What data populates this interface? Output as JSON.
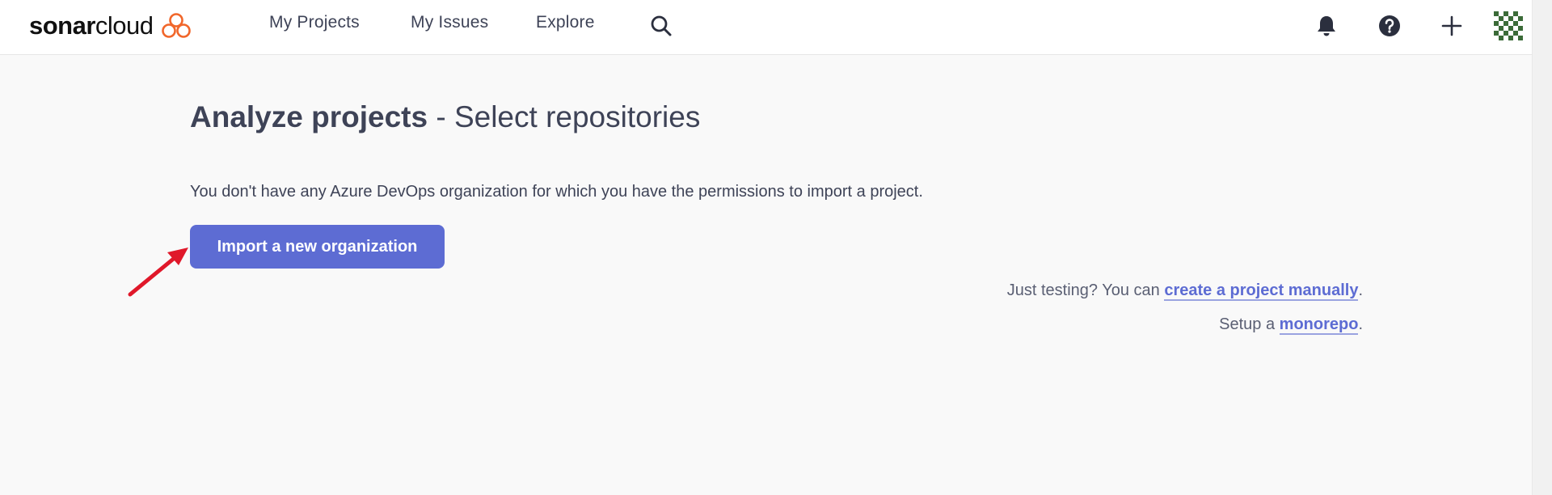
{
  "header": {
    "logo": {
      "part1": "sonar",
      "part2": "cloud",
      "icon": "sonarcloud-cloud-icon",
      "accent": "#f1662a"
    },
    "nav": [
      {
        "label": "My Projects"
      },
      {
        "label": "My Issues"
      },
      {
        "label": "Explore"
      }
    ],
    "icons": [
      "search-icon",
      "bell-icon",
      "help-icon",
      "plus-icon",
      "avatar"
    ]
  },
  "main": {
    "title_strong": "Analyze projects",
    "title_sep": " - ",
    "title_rest": "Select repositories",
    "notice": "You don't have any Azure DevOps organization for which you have the permissions to import a project.",
    "import_button": "Import a new organization",
    "testing_prefix": "Just testing? You can ",
    "testing_link": "create a project manually",
    "testing_suffix": ".",
    "monorepo_prefix": "Setup a ",
    "monorepo_link": "monorepo",
    "monorepo_suffix": "."
  },
  "colors": {
    "primary": "#5d6cd3",
    "text": "#3e4357",
    "annotation_arrow": "#e0182a"
  }
}
